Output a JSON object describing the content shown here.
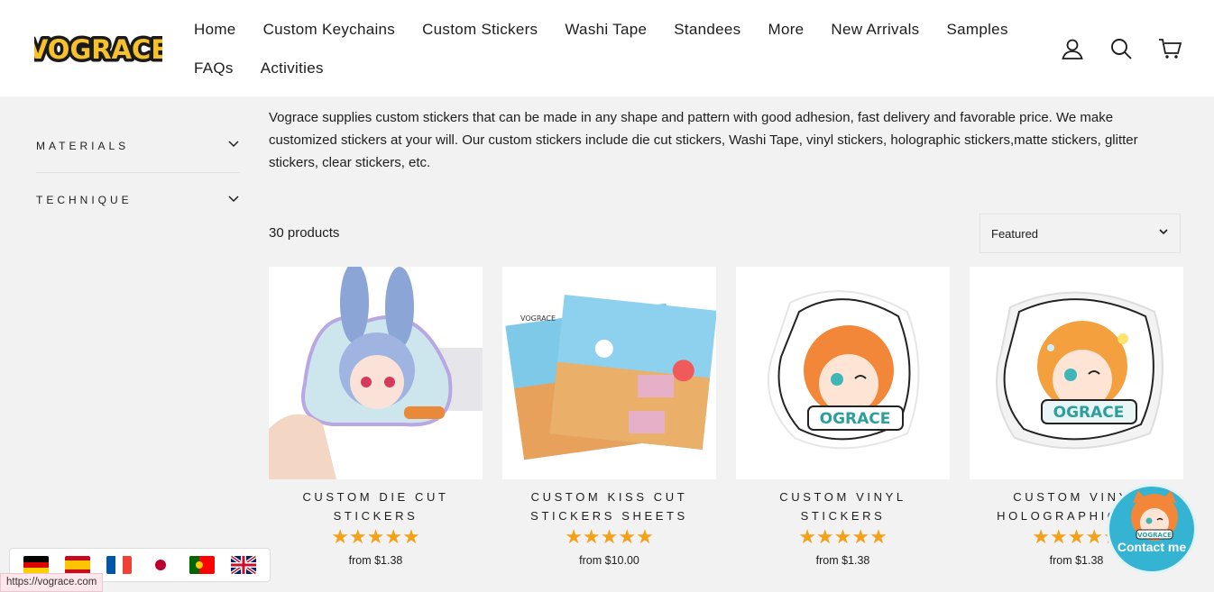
{
  "brand": {
    "logo_text": "VOGRACE",
    "accent": "#f4a11a",
    "logo_color": "#f6c12b"
  },
  "nav": {
    "row1": [
      "Home",
      "Custom Keychains",
      "Custom Stickers",
      "Washi Tape",
      "Standees",
      "More",
      "New Arrivals",
      "Samples"
    ],
    "row2": [
      "FAQs",
      "Activities"
    ]
  },
  "header_icons": [
    "account-icon",
    "search-icon",
    "cart-icon"
  ],
  "sidebar": {
    "filters": [
      {
        "label": "MATERIALS"
      },
      {
        "label": "TECHNIQUE"
      }
    ]
  },
  "description": "Vograce supplies custom stickers that can be made in any shape and pattern with good adhesion, fast delivery and favorable price. We make customized stickers at your will. Our custom stickers include die cut stickers, Washi Tape, vinyl stickers, holographic stickers,matte stickers, glitter stickers, clear stickers, etc.",
  "product_count": "30 products",
  "sort": {
    "value": "Featured"
  },
  "products": [
    {
      "title": "CUSTOM DIE CUT STICKERS",
      "stars": "★★★★★",
      "price": "from $1.38"
    },
    {
      "title": "CUSTOM KISS CUT STICKERS SHEETS",
      "stars": "★★★★★",
      "price": "from $10.00"
    },
    {
      "title": "CUSTOM VINYL STICKERS",
      "stars": "★★★★★",
      "price": "from $1.38"
    },
    {
      "title": "CUSTOM VINYL HOLOGRAPHIC S...",
      "stars": "★★★★★",
      "price": "from $1.38"
    }
  ],
  "languages": [
    "German",
    "Spanish",
    "French",
    "Japanese",
    "Portuguese",
    "English"
  ],
  "status_url": "https://vograce.com",
  "contact": {
    "label": "Contact me",
    "badge": "VOGRACE"
  }
}
